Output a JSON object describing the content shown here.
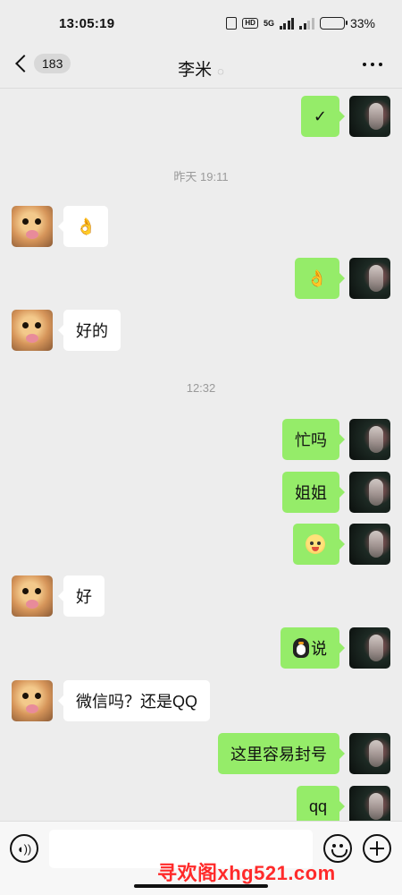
{
  "status_bar": {
    "time": "13:05:19",
    "hd": "HD",
    "net": "5G",
    "battery": "33%"
  },
  "nav": {
    "unread_count": "183",
    "title": "李米"
  },
  "messages": {
    "m1": "✓",
    "ts1": "昨天 19:11",
    "m2": "👌",
    "m3": "👌",
    "m4": "好的",
    "ts2": "12:32",
    "m5": "忙吗",
    "m6": "姐姐",
    "m8": "好",
    "m9": "说",
    "m10": "微信吗？还是QQ",
    "m11": "这里容易封号",
    "m12": "qq"
  },
  "input": {
    "placeholder": ""
  },
  "watermark": "寻欢阁xhg521.com"
}
